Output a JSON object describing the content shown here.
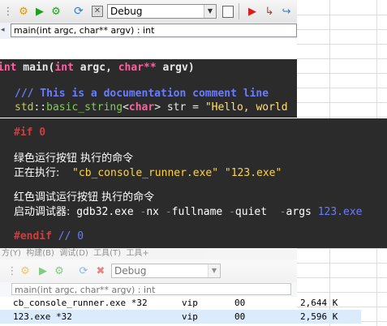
{
  "toolbar_top": {
    "build_config": "Debug",
    "icons": [
      "settings-gear-icon",
      "run-icon",
      "build-run-icon",
      "rebuild-icon",
      "abort-icon",
      "build-target-icon",
      "debug-run-icon",
      "step-into-icon",
      "next-line-icon"
    ]
  },
  "function_bar": {
    "value": "main(int argc, char** argv) : int"
  },
  "editor": {
    "line1": {
      "kw_int": "int",
      "func": " main(",
      "kw_int2": "int",
      "argc": " argc, ",
      "kw_char": "char",
      "stars": "** ",
      "argv": "argv)"
    },
    "line2": "/// This is a documentation comment line",
    "line3": {
      "ns": "std",
      "sep": "::",
      "type": "basic_string",
      "lt": "<",
      "tchar": "char",
      "gt": ">",
      "var": " str = ",
      "str": "\"Hello, world"
    }
  },
  "overlay": {
    "if_line": "#if 0",
    "green_title": "绿色运行按钮 执行的命令",
    "exec_label": "正在执行:",
    "exec_cmd": "\"cb_console_runner.exe\" \"123.exe\"",
    "red_title": "红色调试运行按钮 执行的命令",
    "debug_label": "启动调试器:",
    "debug_cmd": {
      "exe": "gdb32.exe ",
      "d1": "-",
      "nx": "nx ",
      "d2": "-",
      "full": "fullname ",
      "d3": "-",
      "quiet": "quiet  ",
      "d4": "-",
      "args": "args ",
      "arg": "123.exe"
    },
    "endif_line": {
      "kw": "#endif",
      "comment": " // 0"
    }
  },
  "bottom": {
    "menubar_text": "方(Y)  构建(B)  调试(D)  工具(T)  工具+",
    "build_config": "Debug",
    "function_bar": "main(int argc, char** argv) : int"
  },
  "processes": [
    {
      "name": "cb_console_runner.exe *32",
      "user": "vip",
      "cpu": "00",
      "mem": "2,644 K"
    },
    {
      "name": "123.exe *32",
      "user": "vip",
      "cpu": "00",
      "mem": "2,596 K"
    }
  ],
  "colors": {
    "editor_bg": "#2b2b2b",
    "keyword": "#ff5fa0",
    "doc_comment": "#6a7cff",
    "namespace": "#c0d040",
    "type": "#7fd050",
    "string": "#ffe070",
    "preproc": "#c84040",
    "cmd": "#ffd24a",
    "arg": "#6a7cff"
  }
}
